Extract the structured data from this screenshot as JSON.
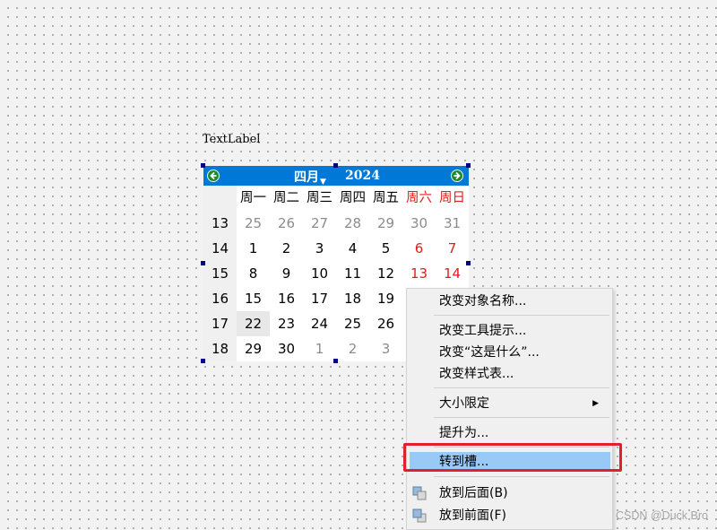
{
  "label": {
    "text": "TextLabel"
  },
  "calendar": {
    "month": "四月",
    "year": "2024",
    "weekdays": [
      "周一",
      "周二",
      "周三",
      "周四",
      "周五",
      "周六",
      "周日"
    ],
    "weeks": [
      {
        "num": "13",
        "days": [
          "25",
          "26",
          "27",
          "28",
          "29",
          "30",
          "31"
        ]
      },
      {
        "num": "14",
        "days": [
          "1",
          "2",
          "3",
          "4",
          "5",
          "6",
          "7"
        ]
      },
      {
        "num": "15",
        "days": [
          "8",
          "9",
          "10",
          "11",
          "12",
          "13",
          "14"
        ]
      },
      {
        "num": "16",
        "days": [
          "15",
          "16",
          "17",
          "18",
          "19",
          "",
          ""
        ]
      },
      {
        "num": "17",
        "days": [
          "22",
          "23",
          "24",
          "25",
          "26",
          "",
          ""
        ]
      },
      {
        "num": "18",
        "days": [
          "29",
          "30",
          "1",
          "2",
          "3",
          "",
          ""
        ]
      }
    ],
    "selected_day": "22",
    "weekend_color": "#e31b1b",
    "header_color": "#0078d7"
  },
  "context_menu": {
    "items": {
      "rename": "改变对象名称...",
      "tooltip": "改变工具提示...",
      "whatsthis": "改变“这是什么”...",
      "stylesheet": "改变样式表...",
      "sizelimit": "大小限定",
      "promote": "提升为...",
      "gotoslot": "转到槽...",
      "sendback": "放到后面(B)",
      "bringfront": "放到前面(F)"
    },
    "highlight_color": "#99c9f6",
    "annotation_color": "#e0202a"
  },
  "watermark": "CSDN @Duck Bro"
}
